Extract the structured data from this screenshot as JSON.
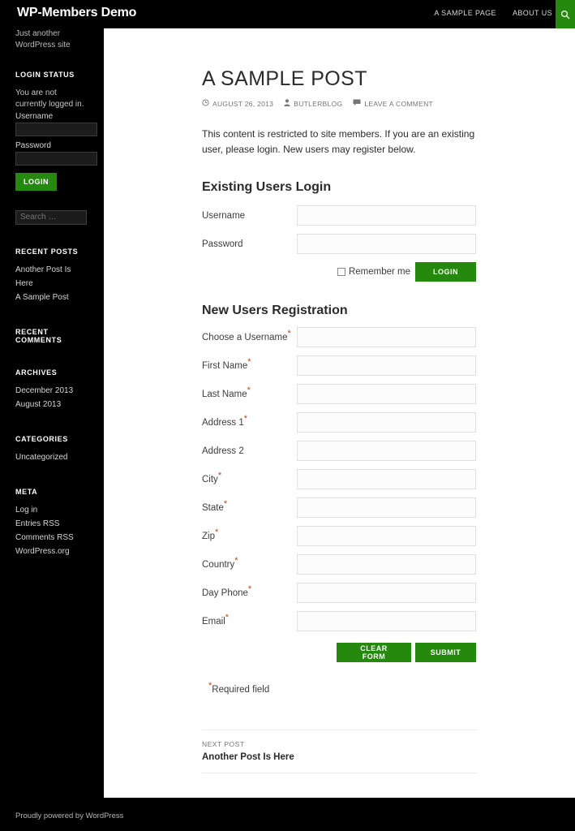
{
  "header": {
    "site_title": "WP-Members Demo",
    "nav": [
      {
        "label": "A SAMPLE PAGE"
      },
      {
        "label": "ABOUT US"
      }
    ],
    "search_icon": "search-icon"
  },
  "sidebar": {
    "site_description": "Just another WordPress site",
    "login_status": {
      "title": "LOGIN STATUS",
      "status_text": "You are not currently logged in.",
      "username_label": "Username",
      "password_label": "Password",
      "login_button": "LOGIN"
    },
    "search": {
      "placeholder": "Search …"
    },
    "recent_posts": {
      "title": "RECENT POSTS",
      "items": [
        {
          "label": "Another Post Is Here"
        },
        {
          "label": "A Sample Post"
        }
      ]
    },
    "recent_comments": {
      "title": "RECENT COMMENTS",
      "items": []
    },
    "archives": {
      "title": "ARCHIVES",
      "items": [
        {
          "label": "December 2013"
        },
        {
          "label": "August 2013"
        }
      ]
    },
    "categories": {
      "title": "CATEGORIES",
      "items": [
        {
          "label": "Uncategorized"
        }
      ]
    },
    "meta": {
      "title": "META",
      "items": [
        {
          "label": "Log in"
        },
        {
          "label": "Entries RSS"
        },
        {
          "label": "Comments RSS"
        },
        {
          "label": "WordPress.org"
        }
      ]
    }
  },
  "post": {
    "title": "A SAMPLE POST",
    "meta": {
      "date": "AUGUST 26, 2013",
      "author": "BUTLERBLOG",
      "comments": "LEAVE A COMMENT"
    },
    "restricted_message": "This content is restricted to site members. If you are an existing user, please login. New users may register below."
  },
  "login_form": {
    "heading": "Existing Users Login",
    "fields": [
      {
        "label": "Username",
        "value": ""
      },
      {
        "label": "Password",
        "value": ""
      }
    ],
    "remember_label": "Remember me",
    "submit_label": "LOGIN"
  },
  "registration_form": {
    "heading": "New Users Registration",
    "fields": [
      {
        "label": "Choose a Username",
        "required": true,
        "value": ""
      },
      {
        "label": "First Name",
        "required": true,
        "value": ""
      },
      {
        "label": "Last Name",
        "required": true,
        "value": ""
      },
      {
        "label": "Address 1",
        "required": true,
        "value": ""
      },
      {
        "label": "Address 2",
        "required": false,
        "value": ""
      },
      {
        "label": "City",
        "required": true,
        "value": ""
      },
      {
        "label": "State",
        "required": true,
        "value": ""
      },
      {
        "label": "Zip",
        "required": true,
        "value": ""
      },
      {
        "label": "Country",
        "required": true,
        "value": ""
      },
      {
        "label": "Day Phone",
        "required": true,
        "value": ""
      },
      {
        "label": "Email",
        "required": true,
        "value": ""
      }
    ],
    "clear_label": "CLEAR FORM",
    "submit_label": "SUBMIT",
    "required_note": "Required field"
  },
  "post_navigation": {
    "next_label": "NEXT POST",
    "next_title": "Another Post Is Here"
  },
  "footer": {
    "credit": "Proudly powered by WordPress"
  },
  "colors": {
    "accent_green": "#24890d",
    "required_red": "#c0451e",
    "background_black": "#000000"
  }
}
